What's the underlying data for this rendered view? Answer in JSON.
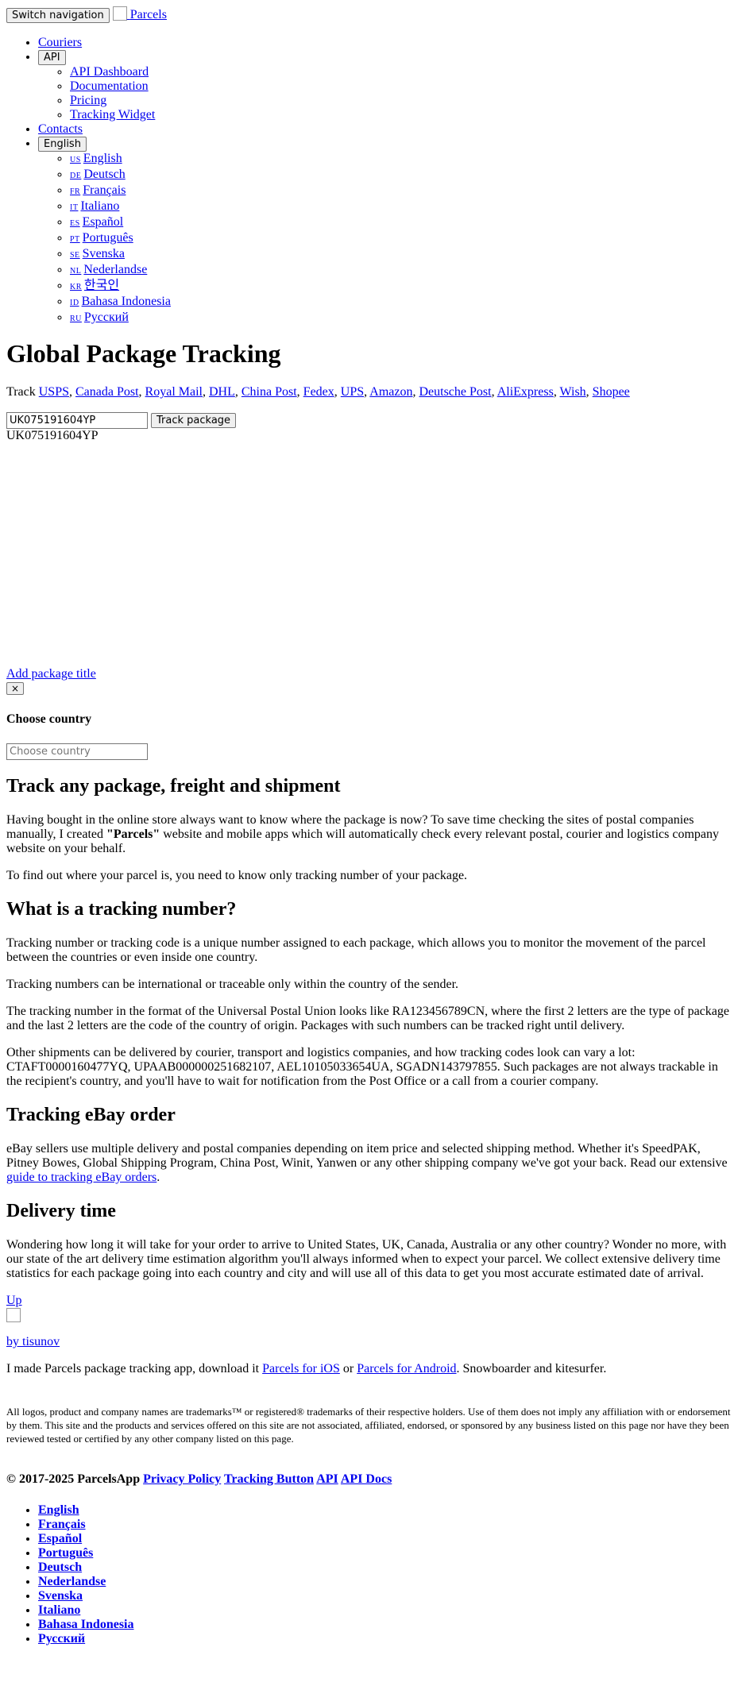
{
  "nav": {
    "toggle_label": "Switch navigation",
    "brand": "Parcels",
    "items": {
      "couriers": "Couriers",
      "api_button": "API",
      "api_items": [
        "API Dashboard",
        "Documentation",
        "Pricing",
        "Tracking Widget"
      ],
      "contacts": "Contacts",
      "language_button": "English",
      "languages": [
        {
          "code": "US",
          "name": "English"
        },
        {
          "code": "DE",
          "name": "Deutsch"
        },
        {
          "code": "FR",
          "name": "Français"
        },
        {
          "code": "IT",
          "name": "Italiano"
        },
        {
          "code": "ES",
          "name": "Español"
        },
        {
          "code": "PT",
          "name": "Português"
        },
        {
          "code": "SE",
          "name": "Svenska"
        },
        {
          "code": "NL",
          "name": "Nederlandse"
        },
        {
          "code": "KR",
          "name": "한국인"
        },
        {
          "code": "ID",
          "name": "Bahasa Indonesia"
        },
        {
          "code": "RU",
          "name": "Русский"
        }
      ]
    }
  },
  "hero": {
    "title": "Global Package Tracking",
    "track_prefix": "Track",
    "carriers": [
      "USPS",
      "Canada Post",
      "Royal Mail",
      "DHL",
      "China Post",
      "Fedex",
      "UPS",
      "Amazon",
      "Deutsche Post",
      "AliExpress",
      "Wish",
      "Shopee"
    ],
    "input_value": "UK075191604YP",
    "track_button": "Track package",
    "tracking_number": "UK075191604YP"
  },
  "modal": {
    "add_title_link": "Add package title",
    "close_label": "×",
    "heading": "Choose country",
    "input_placeholder": "Choose country"
  },
  "content": {
    "h_track_any": "Track any package, freight and shipment",
    "p1_before": "Having bought in the online store always want to know where the package is now? To save time checking the sites of postal companies manually, I created ",
    "p1_bold": "\"Parcels\"",
    "p1_after": " website and mobile apps which will automatically check every relevant postal, courier and logistics company website on your behalf.",
    "p2": "To find out where your parcel is, you need to know only tracking number of your package.",
    "h_tracking_number": "What is a tracking number?",
    "p3": "Tracking number or tracking code is a unique number assigned to each package, which allows you to monitor the movement of the parcel between the countries or even inside one country.",
    "p4": "Tracking numbers can be international or traceable only within the country of the sender.",
    "p5": "The tracking number in the format of the Universal Postal Union looks like RA123456789CN, where the first 2 letters are the type of package and the last 2 letters are the code of the country of origin. Packages with such numbers can be tracked right until delivery.",
    "p6": "Other shipments can be delivered by courier, transport and logistics companies, and how tracking codes look can vary a lot: CTAFT0000160477YQ, UPAAB000000251682107, AEL10105033654UA, SGADN143797855. Such packages are not always trackable in the recipient's country, and you'll have to wait for notification from the Post Office or a call from a courier company.",
    "h_ebay": "Tracking eBay order",
    "p7_before": "eBay sellers use multiple delivery and postal companies depending on item price and selected shipping method. Whether it's SpeedPAK, Pitney Bowes, Global Shipping Program, China Post, Winit, Yanwen or any other shipping company we've got your back. Read our extensive ",
    "p7_link": "guide to tracking eBay orders",
    "p7_after": ".",
    "h_delivery": "Delivery time",
    "p8": "Wondering how long it will take for your order to arrive to United States, UK, Canada, Australia or any other country? Wonder no more, with our state of the art delivery time estimation algorithm you'll always informed when to expect your parcel. We collect extensive delivery time statistics for each package going into each country and city and will use all of this data to get you most accurate estimated date of arrival."
  },
  "author": {
    "up_link": "Up",
    "by_link": "by tisunov",
    "text_before": "I made Parcels package tracking app, download it ",
    "ios_link": "Parcels for iOS",
    "text_or": " or ",
    "android_link": "Parcels for Android",
    "text_after": ". Snowboarder and kitesurfer."
  },
  "footer": {
    "disclaimer": "All logos, product and company names are trademarks™ or registered® trademarks of their respective holders. Use of them does not imply any affiliation with or endorsement by them. This site and the products and services offered on this site are not associated, affiliated, endorsed, or sponsored by any business listed on this page nor have they been reviewed tested or certified by any other company listed on this page.",
    "copyright": "© 2017-2025 ParcelsApp",
    "links": [
      "Privacy Policy",
      "Tracking Button",
      "API",
      "API Docs"
    ],
    "languages": [
      "English",
      "Français",
      "Español",
      "Português",
      "Deutsch",
      "Nederlandse",
      "Svenska",
      "Italiano",
      "Bahasa Indonesia",
      "Русский"
    ]
  }
}
